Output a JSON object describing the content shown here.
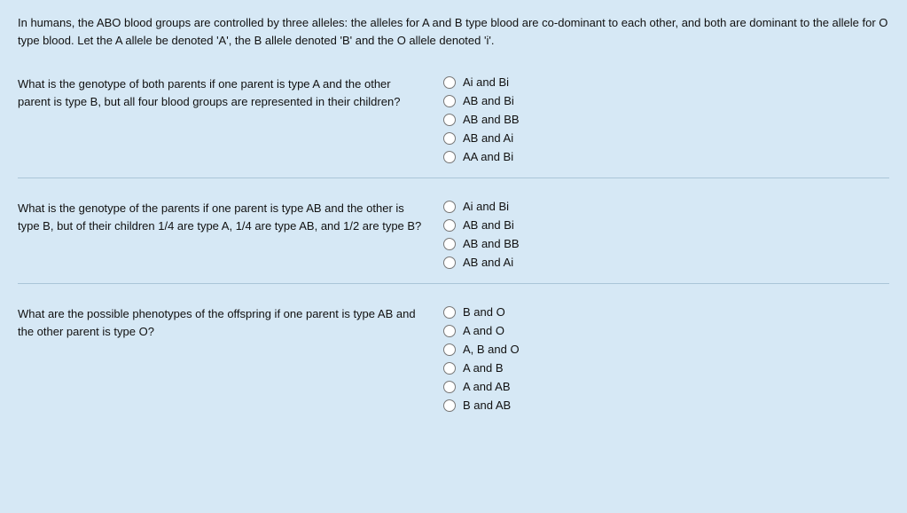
{
  "intro": {
    "text": "In humans, the ABO blood groups are controlled by three alleles: the alleles for A and B type blood are co-dominant to each other, and both are dominant to the allele for O type blood. Let the A allele be denoted 'A', the B allele denoted 'B' and the O allele denoted 'i'."
  },
  "questions": [
    {
      "id": "q1",
      "text": "What is the genotype of both parents if one parent is type A and the other parent is type B, but all four blood groups are represented in their children?",
      "options": [
        "Ai and Bi",
        "AB and Bi",
        "AB and BB",
        "AB and Ai",
        "AA and Bi"
      ]
    },
    {
      "id": "q2",
      "text": "What is the genotype of the parents if one parent is type AB and the other is type B, but of their children 1/4 are type A, 1/4 are type AB, and 1/2 are type B?",
      "options": [
        "Ai and Bi",
        "AB and Bi",
        "AB and BB",
        "AB and Ai"
      ]
    },
    {
      "id": "q3",
      "text": "What are the possible phenotypes of the offspring if one parent is type AB and the other parent is type O?",
      "options": [
        "B and O",
        "A and O",
        "A, B and O",
        "A and B",
        "A and AB",
        "B and AB"
      ]
    }
  ]
}
